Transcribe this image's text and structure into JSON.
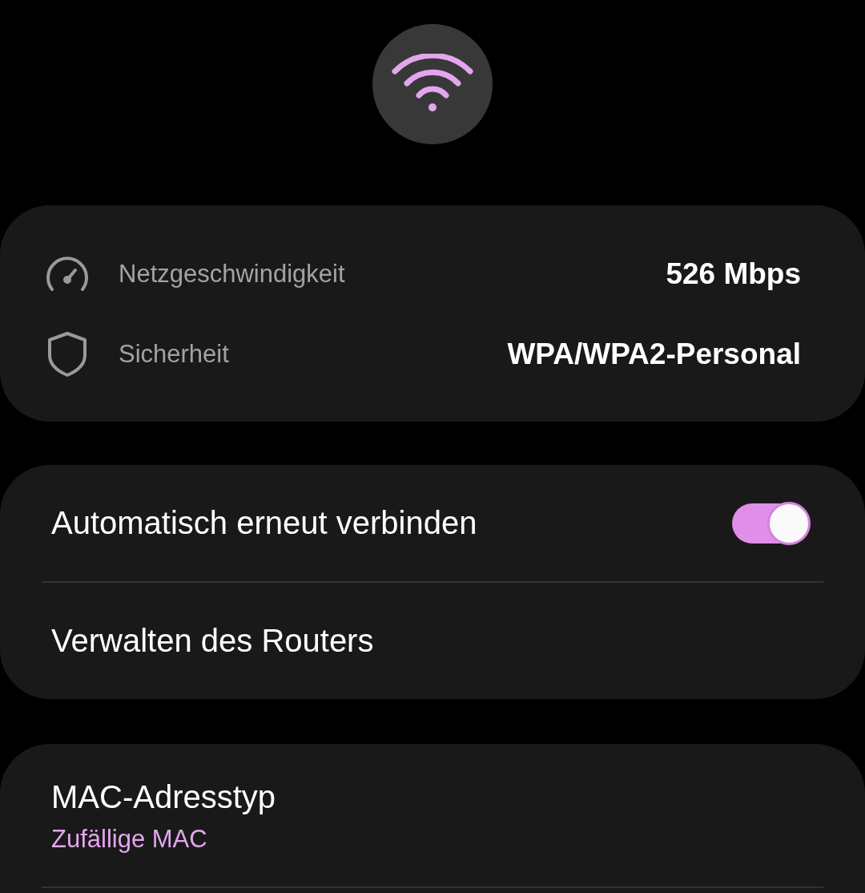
{
  "info_card": {
    "rows": [
      {
        "kind": "speed",
        "label": "Netzgeschwindigkeit",
        "value": "526 Mbps"
      },
      {
        "kind": "security",
        "label": "Sicherheit",
        "value": "WPA/WPA2-Personal"
      }
    ]
  },
  "settings_card": {
    "items": [
      {
        "kind": "toggle",
        "label": "Automatisch erneut verbinden",
        "on": true
      },
      {
        "kind": "link",
        "label": "Verwalten des Routers"
      }
    ]
  },
  "mac_card": {
    "items": [
      {
        "kind": "detail",
        "label": "MAC-Adresstyp",
        "value": "Zufällige MAC"
      }
    ]
  }
}
